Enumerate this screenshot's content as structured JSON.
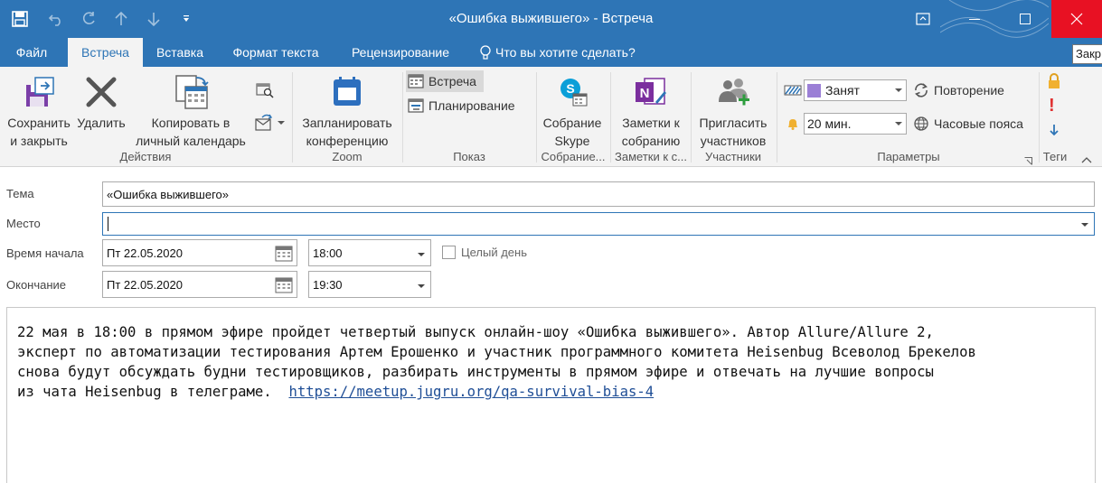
{
  "window": {
    "title": "«Ошибка выжившего» - Встреча",
    "tooltip": "Закр"
  },
  "menu_tabs": [
    {
      "label": "Файл"
    },
    {
      "label": "Встреча"
    },
    {
      "label": "Вставка"
    },
    {
      "label": "Формат текста"
    },
    {
      "label": "Рецензирование"
    },
    {
      "label": "Что вы хотите сделать?"
    }
  ],
  "ribbon": {
    "actions": {
      "group_label": "Действия",
      "save_close": [
        "Сохранить",
        "и закрыть"
      ],
      "delete": "Удалить",
      "copy": [
        "Копировать в",
        "личный календарь"
      ]
    },
    "zoom": {
      "group_label": "Zoom",
      "schedule": [
        "Запланировать",
        "конференцию"
      ]
    },
    "show": {
      "group_label": "Показ",
      "meeting": "Встреча",
      "planning": "Планирование"
    },
    "skype": {
      "group_label": "Собрание...",
      "button": [
        "Собрание",
        "Skype"
      ]
    },
    "notes": {
      "group_label": "Заметки к с...",
      "button": [
        "Заметки к",
        "собранию"
      ]
    },
    "attendees": {
      "group_label": "Участники",
      "button": [
        "Пригласить",
        "участников"
      ]
    },
    "options": {
      "group_label": "Параметры",
      "show_as": "Занят",
      "reminder": "20 мин.",
      "recurrence": "Повторение",
      "time_zones": "Часовые пояса"
    },
    "tags": {
      "group_label": "Теги"
    }
  },
  "form": {
    "subject_label": "Тема",
    "subject_value": "«Ошибка выжившего»",
    "location_label": "Место",
    "location_value": "",
    "start_label": "Время начала",
    "start_date": "Пт 22.05.2020",
    "start_time": "18:00",
    "all_day_label": "Целый день",
    "end_label": "Окончание",
    "end_date": "Пт 22.05.2020",
    "end_time": "19:30"
  },
  "body": {
    "text": "22 мая в 18:00 в прямом эфире пройдет четвертый выпуск онлайн-шоу «Ошибка выжившего». Автор Allure/Allure 2,\nэксперт по автоматизации тестирования Артем Ерошенко и участник программного комитета Heisenbug Всеволод Брекелов\nснова будут обсуждать будни тестировщиков, разбирать инструменты в прямом эфире и отвечать на лучшие вопросы\nиз чата Heisenbug в телеграме.  ",
    "link": "https://meetup.jugru.org/qa-survival-bias-4"
  },
  "colors": {
    "accent": "#2e75b6",
    "close": "#e81123",
    "busy": "#9b7fd6",
    "reminder_bell": "#f0b030",
    "importance_high": "#e03030",
    "importance_low": "#2e75b6",
    "zoom": "#2d6fbe",
    "skype": "#0a9fd8",
    "onenote": "#7b2f9e"
  }
}
